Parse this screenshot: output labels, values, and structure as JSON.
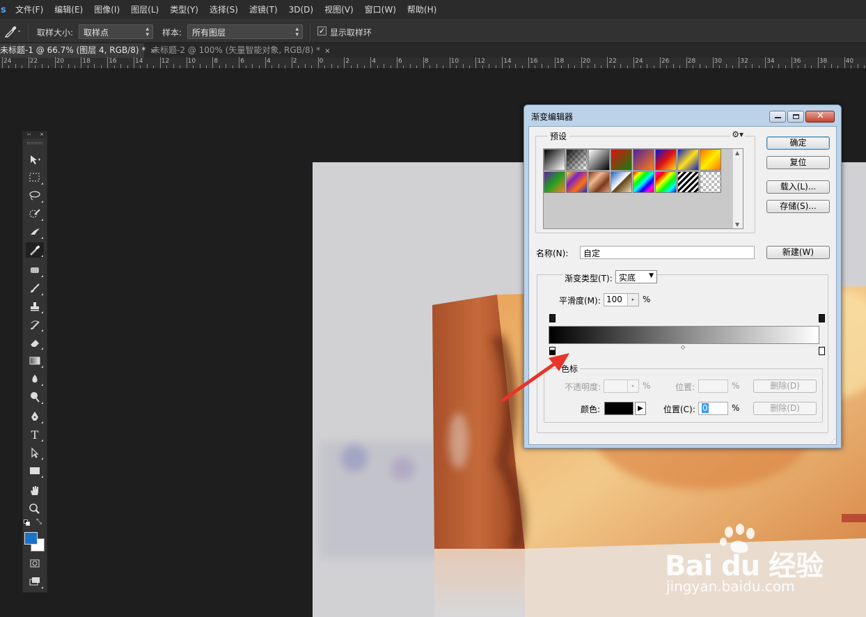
{
  "app": {
    "logo": "s"
  },
  "menu": [
    "文件(F)",
    "编辑(E)",
    "图像(I)",
    "图层(L)",
    "类型(Y)",
    "选择(S)",
    "滤镜(T)",
    "3D(D)",
    "视图(V)",
    "窗口(W)",
    "帮助(H)"
  ],
  "options": {
    "sample_size_label": "取样大小:",
    "sample_size_value": "取样点",
    "sample_label": "样本:",
    "sample_value": "所有图层",
    "show_ring_label": "显示取样环",
    "show_ring_checked": true
  },
  "tabs": [
    {
      "label": "未标题-1 @ 66.7% (图层 4, RGB/8) *",
      "close": "×",
      "active": true
    },
    {
      "label": "未标题-2 @ 100% (矢量智能对象, RGB/8) *",
      "close": "×",
      "active": false
    }
  ],
  "ruler_labels": [
    "24",
    "22",
    "20",
    "18",
    "16",
    "14",
    "12",
    "10",
    "8",
    "6",
    "4",
    "2",
    "0",
    "2",
    "4",
    "6",
    "8",
    "10",
    "12",
    "14",
    "16",
    "18",
    "20",
    "22",
    "24",
    "26",
    "28",
    "30",
    "32",
    "34",
    "36",
    "38",
    "40"
  ],
  "tools": [
    "move-tool",
    "marquee-tool",
    "lasso-tool",
    "quick-select-tool",
    "crop-tool",
    "eyedropper-tool",
    "healing-brush-tool",
    "brush-tool",
    "clone-stamp-tool",
    "history-brush-tool",
    "eraser-tool",
    "gradient-tool",
    "blur-tool",
    "dodge-tool",
    "pen-tool",
    "type-tool",
    "path-select-tool",
    "rectangle-tool",
    "hand-tool",
    "zoom-tool"
  ],
  "colors": {
    "foreground": "#1a73c8",
    "background": "#ffffff",
    "accent_arrow": "#e8342a"
  },
  "dialog": {
    "title": "渐变编辑器",
    "presets_label": "预设",
    "ok": "确定",
    "reset": "复位",
    "load": "载入(L)...",
    "save": "存储(S)...",
    "name_label": "名称(N):",
    "name_value": "自定",
    "new": "新建(W)",
    "gradient_type_label": "渐变类型(T):",
    "gradient_type_value": "实底",
    "smoothness_label": "平滑度(M):",
    "smoothness_value": "100",
    "percent": "%",
    "stops_label": "色标",
    "opacity_label": "不透明度:",
    "opacity_percent": "%",
    "location_label_1": "位置:",
    "location_percent_1": "%",
    "delete_1": "删除(D)",
    "color_label": "颜色:",
    "location_label_2": "位置(C):",
    "location_value_2": "0",
    "location_percent_2": "%",
    "delete_2": "删除(D)",
    "presets": [
      "black-white",
      "transparent",
      "black-white-2",
      "red-green",
      "violet-orange",
      "blue-red-yellow",
      "blue-yellow-blue",
      "orange-yellow-orange",
      "violet-green-orange",
      "yellow-violet-orange-blue",
      "copper",
      "chrome",
      "spectrum",
      "transparent-rainbow",
      "transparent-stripes",
      "transparent-2"
    ]
  },
  "watermark": {
    "brand": "Bai du 经验",
    "url": "jingyan.baidu.com"
  }
}
